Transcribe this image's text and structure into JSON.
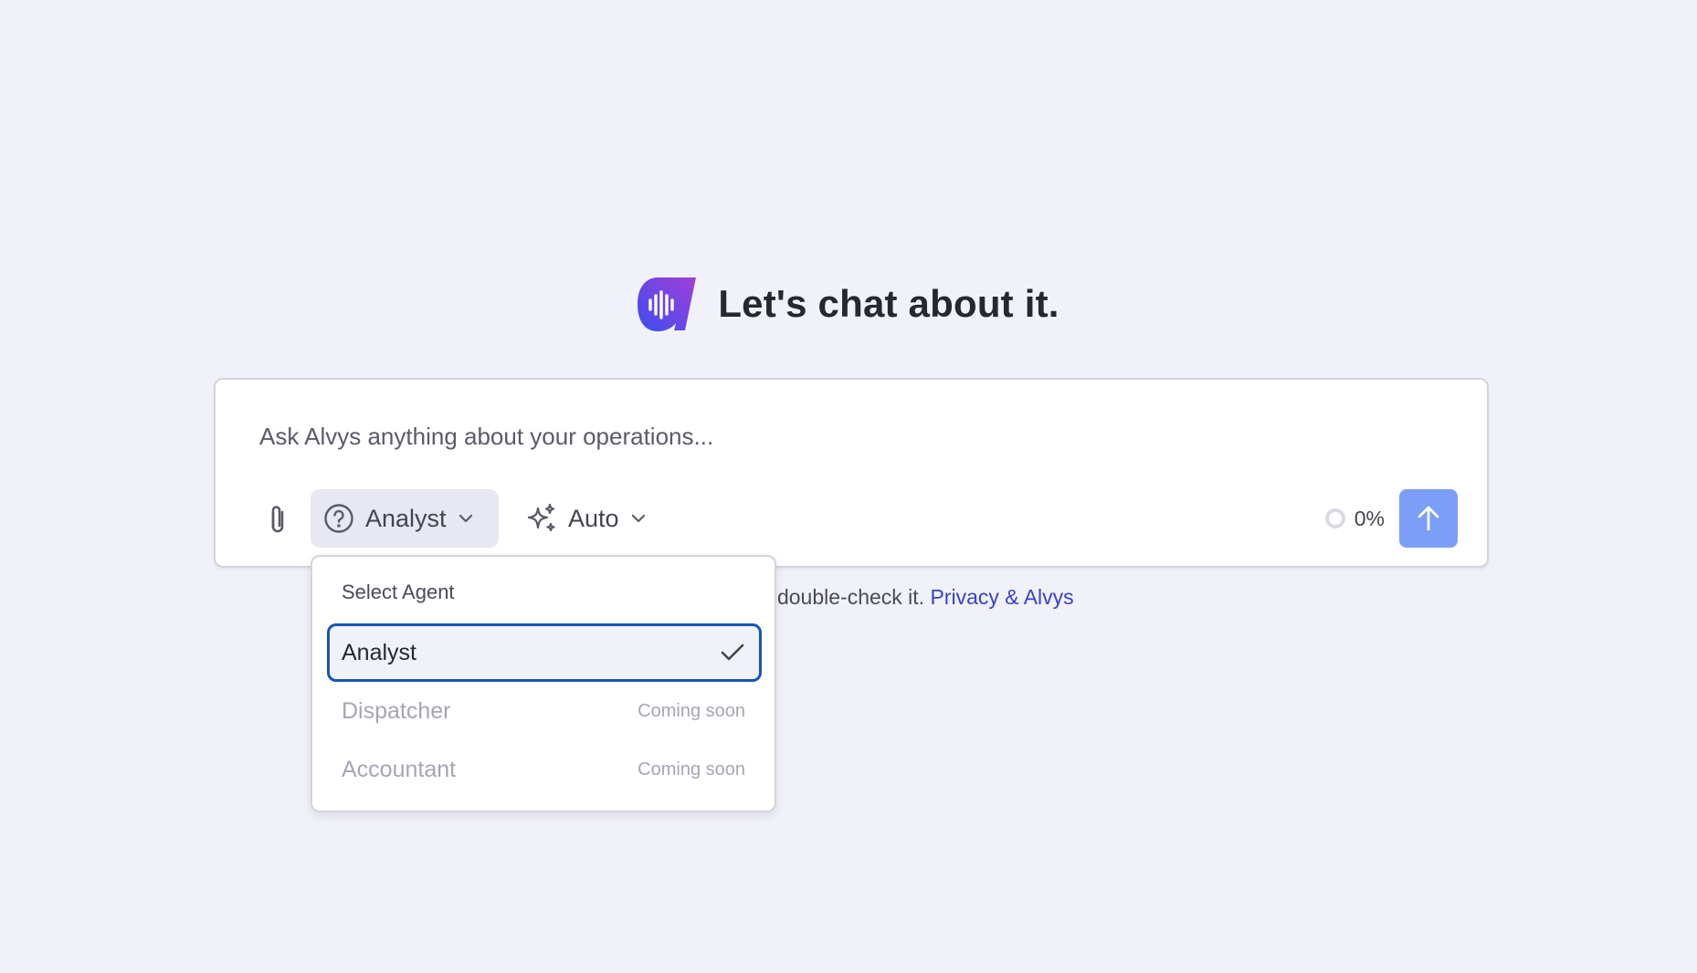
{
  "hero": {
    "title": "Let's chat about it.",
    "logo_icon": "alvys-voice-logo"
  },
  "composer": {
    "placeholder": "Ask Alvys anything about your operations...",
    "attach_icon": "paperclip-icon",
    "agent_selector": {
      "icon": "question-circle-icon",
      "label": "Analyst"
    },
    "model_selector": {
      "icon": "sparkles-icon",
      "label": "Auto"
    },
    "context_usage": "0%",
    "send_icon": "arrow-up-icon"
  },
  "disclaimer": {
    "visible_text": "s, so double-check it.",
    "link_text": "Privacy & Alvys"
  },
  "agent_menu": {
    "heading": "Select Agent",
    "items": [
      {
        "label": "Analyst",
        "selected": true,
        "badge": ""
      },
      {
        "label": "Dispatcher",
        "selected": false,
        "badge": "Coming soon"
      },
      {
        "label": "Accountant",
        "selected": false,
        "badge": "Coming soon"
      }
    ]
  },
  "colors": {
    "background": "#f1f2f9",
    "accent": "#7b9ef7",
    "selected_border": "#1556b8",
    "link": "#3a40cc",
    "logo_gradient": [
      "#3b4ef0",
      "#a23fd8"
    ]
  }
}
